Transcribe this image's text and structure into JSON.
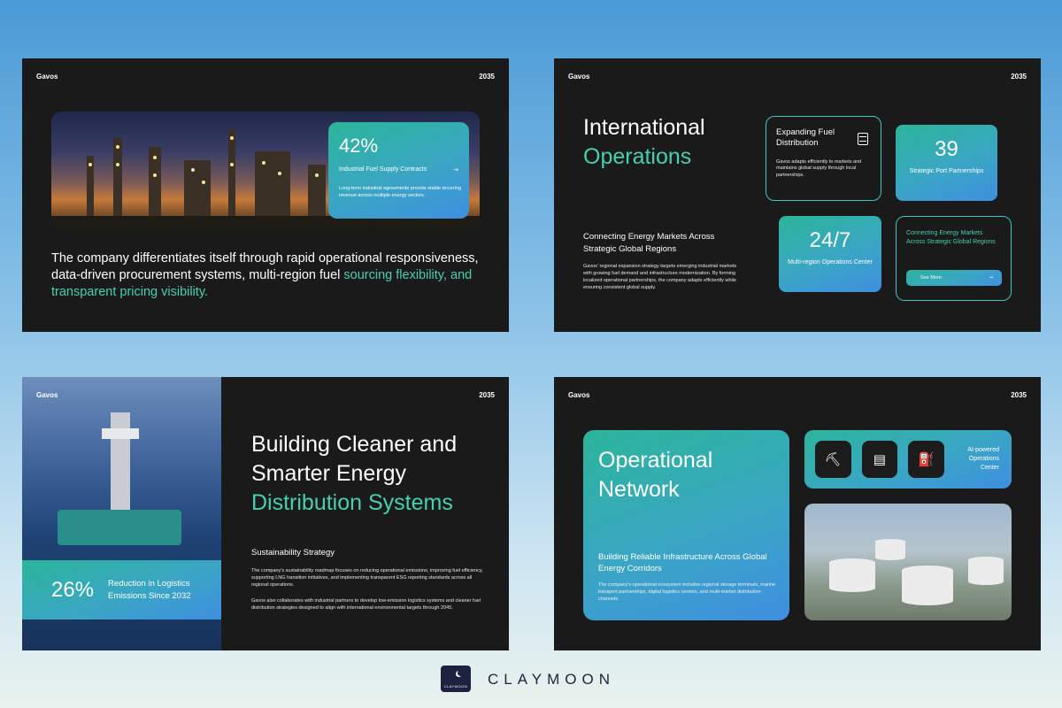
{
  "brand": "Gavos",
  "year": "2035",
  "slide1": {
    "stat_value": "42%",
    "stat_label": "Industrial Fuel Supply Contracts",
    "stat_desc": "Long-term industrial agreements provide stable recurring revenue across multiple energy sectors.",
    "para_main": "The company differentiates itself through rapid operational responsiveness, data-driven procurement systems, multi-region fuel",
    "para_highlight": "sourcing flexibility, and transparent pricing visibility."
  },
  "slide2": {
    "title_line1": "International",
    "title_line2": "Operations",
    "sub_title": "Connecting Energy Markets Across Strategic Global Regions",
    "sub_desc": "Gavos' regional expansion strategy targets emerging industrial markets with growing fuel demand and infrastructure modernization. By forming localized operational partnerships, the company adapts efficiently while ensuring consistent global supply.",
    "card1_title": "Expanding Fuel Distribution",
    "card1_desc": "Gavos adapts efficiently to markets and maintains global supply through local partnerships.",
    "card2_value": "39",
    "card2_label": "Strategic Port Partnerships",
    "card3_value": "24/7",
    "card3_label": "Multi-region Operations Center",
    "card4_title": "Connecting Energy Markets Across Strategic Global Regions",
    "card4_button": "See More"
  },
  "slide3": {
    "stat_value": "26%",
    "stat_label": "Reduction in Logistics Emissions Since 2032",
    "title_line1": "Building Cleaner and",
    "title_line2": "Smarter Energy",
    "title_line3": "Distribution Systems",
    "sub": "Sustainability Strategy",
    "desc1": "The company's sustainability roadmap focuses on reducing operational emissions, improving fuel efficiency, supporting LNG transition initiatives, and implementing transparent ESG reporting standards across all regional operations.",
    "desc2": "Gavos also collaborates with industrial partners to develop low-emission logistics systems and cleaner fuel distribution strategies designed to align with international environmental targets through 2045."
  },
  "slide4": {
    "title_line1": "Operational",
    "title_line2": "Network",
    "sub": "Building Reliable Infrastructure Across Global Energy Corridors",
    "desc": "The company's operational ecosystem includes regional storage terminals, marine transport partnerships, digital logistics centers, and multi-market distribution channels.",
    "icon_label": "AI-powered Operations Center",
    "icons": [
      "oil-pump-icon",
      "fuel-barrel-icon",
      "fuel-pump-icon"
    ]
  },
  "footer": {
    "logo_text": "CLAYMOON",
    "wordmark": "CLAYMOON"
  },
  "colors": {
    "accent": "#45d1ad",
    "gradient_start": "#2bb59a",
    "gradient_end": "#3f8fe0",
    "slide_bg": "#1a1a1a"
  }
}
